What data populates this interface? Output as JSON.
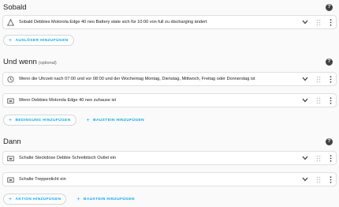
{
  "sections": {
    "trigger": {
      "title": "Sobald",
      "rows": [
        {
          "text": "Sobald Debbies Motorola Edge 40 neo Battery state sich für 10:00 von full zu discharging ändert",
          "icon": "device-icon"
        }
      ],
      "buttons": [
        {
          "label": "AUSLÖSER HINZUFÜGEN",
          "plus": "+"
        }
      ]
    },
    "condition": {
      "title": "Und wenn",
      "optional": "(optional)",
      "rows": [
        {
          "text": "Wenn die Uhrzeit nach 07:00 und vor 08:00 und der Wochentag Montag, Dienstag, Mittwoch, Freitag oder Donnerstag ist",
          "icon": "clock-icon"
        },
        {
          "text": "Wenn Debbies Motorola Edge 40 neo zuhause ist",
          "icon": "device-icon"
        }
      ],
      "buttons": [
        {
          "label": "BEDINGUNG HINZUFÜGEN",
          "plus": "+"
        },
        {
          "label": "BAUSTEIN HINZUFÜGEN",
          "plus": "+"
        }
      ]
    },
    "action": {
      "title": "Dann",
      "rows": [
        {
          "text": "Schalte Steckdose Debbie Schreibtisch Outlet ein",
          "icon": "device-icon"
        },
        {
          "text": "Schalte Treppenlicht ein",
          "icon": "device-icon"
        }
      ],
      "buttons": [
        {
          "label": "AKTION HINZUFÜGEN",
          "plus": "+"
        },
        {
          "label": "BAUSTEIN HINZUFÜGEN",
          "plus": "+"
        }
      ]
    }
  },
  "colors": {
    "accent": "#03a9f4",
    "text": "#212121",
    "icon": "#616161"
  }
}
